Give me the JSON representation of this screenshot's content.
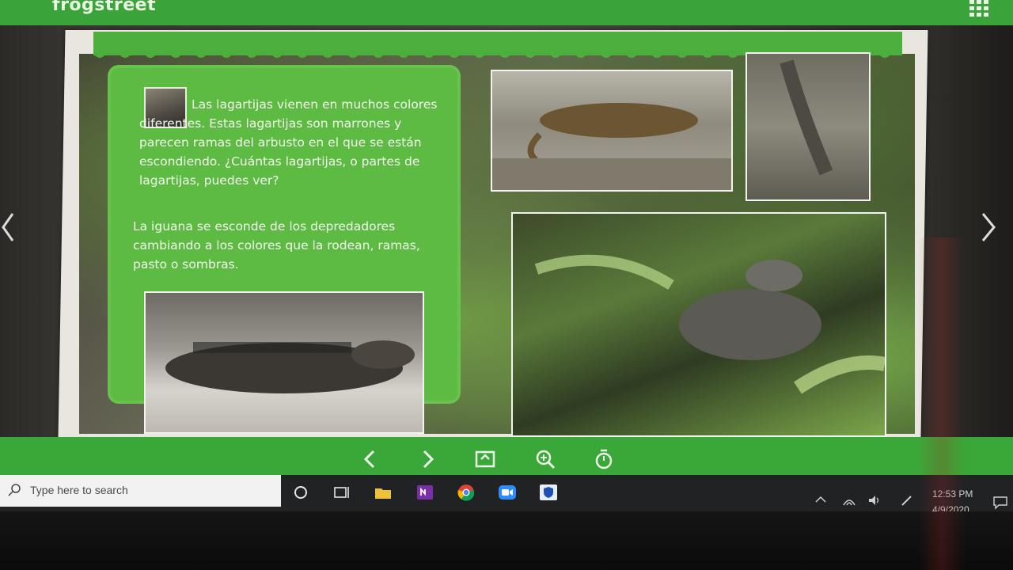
{
  "app": {
    "brand": "frogstreet"
  },
  "book": {
    "paragraph1": "Las lagartijas vienen en muchos colores diferentes. Estas lagartijas son marrones y parecen ramas del arbusto en el que se están escondiendo. ¿Cuántas lagartijas, o partes de lagartijas, puedes ver?",
    "paragraph2": "La iguana se esconde de los depredadores cambiando a los colores que la rodean, ramas, pasto o sombras."
  },
  "taskbar": {
    "search_placeholder": "Type here to search",
    "time": "12:53 PM",
    "date": "4/9/2020"
  },
  "colors": {
    "accent": "#3aa838",
    "panel": "#5dba42"
  }
}
